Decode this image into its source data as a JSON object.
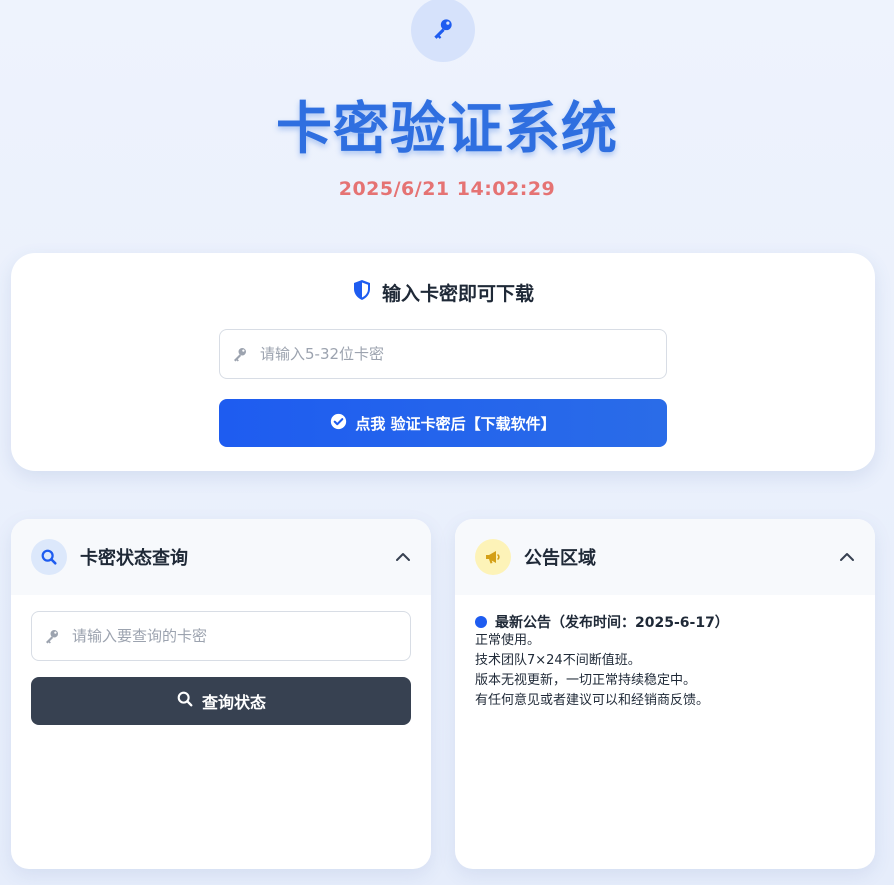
{
  "header": {
    "icon": "key-icon",
    "title": "卡密验证系统",
    "datetime": "2025/6/21 14:02:29"
  },
  "verify_card": {
    "title": "输入卡密即可下载",
    "title_icon": "shield-icon",
    "input_placeholder": "请输入5-32位卡密",
    "button_label": "点我 验证卡密后【下载软件】",
    "button_icon": "check-circle-icon"
  },
  "query_panel": {
    "title": "卡密状态查询",
    "input_placeholder": "请输入要查询的卡密",
    "button_label": "查询状态"
  },
  "notice_panel": {
    "title": "公告区域",
    "heading": "最新公告（发布时间：2025-6-17）",
    "lines": [
      "正常使用。",
      "技术团队7×24不间断值班。",
      "版本无视更新，一切正常持续稳定中。",
      "有任何意见或者建议可以和经销商反馈。"
    ]
  },
  "colors": {
    "primary": "#1e5cf0",
    "title": "#2f6fe0",
    "datetime": "#e57373",
    "dark_button": "#374151",
    "notice_icon_bg": "#fdf3b8",
    "query_icon_bg": "#dce8fb"
  }
}
